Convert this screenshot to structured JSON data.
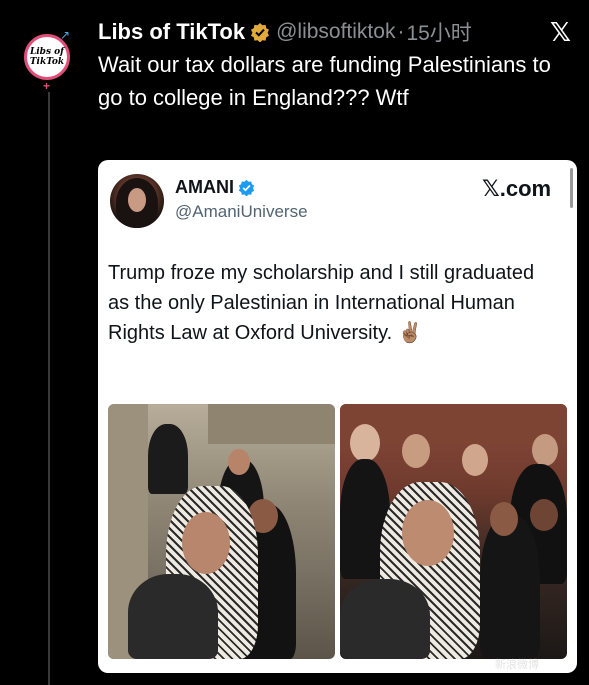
{
  "tweet": {
    "author_name": "Libs of TikTok",
    "author_handle": "@libsoftiktok",
    "separator": "·",
    "time": "15小时",
    "text": "Wait our tax dollars are funding Palestinians to go to college in England??? Wtf",
    "avatar_text": "Libs of TikTok"
  },
  "quoted": {
    "name": "AMANI",
    "handle": "@AmaniUniverse",
    "source": "𝕏.com",
    "text": "Trump froze my scholarship and I still graduated as the only Palestinian in International Human Rights Law at Oxford University. ✌🏽"
  },
  "colors": {
    "background": "#000000",
    "verified_gold": "#e2a93b",
    "verified_blue": "#1d9bf0",
    "handle_gray": "#8b8f94"
  },
  "icons": {
    "verified_org": "gold-verified-badge-icon",
    "verified_user": "blue-verified-badge-icon",
    "close": "x-logo-icon"
  },
  "watermark": "新浪微博"
}
